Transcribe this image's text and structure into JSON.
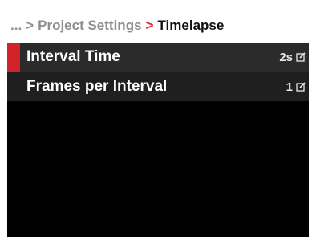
{
  "breadcrumb": {
    "ellipsis": "...",
    "separator": ">",
    "parent": "Project Settings",
    "current": "Timelapse"
  },
  "menu": {
    "items": [
      {
        "label": "Interval Time",
        "value": "2s",
        "icon": "edit-icon",
        "selected": true
      },
      {
        "label": "Frames per Interval",
        "value": "1",
        "icon": "edit-icon",
        "selected": false
      }
    ]
  },
  "colors": {
    "accent": "#d2232a",
    "background": "#000000",
    "row": "#1f1f1f"
  }
}
